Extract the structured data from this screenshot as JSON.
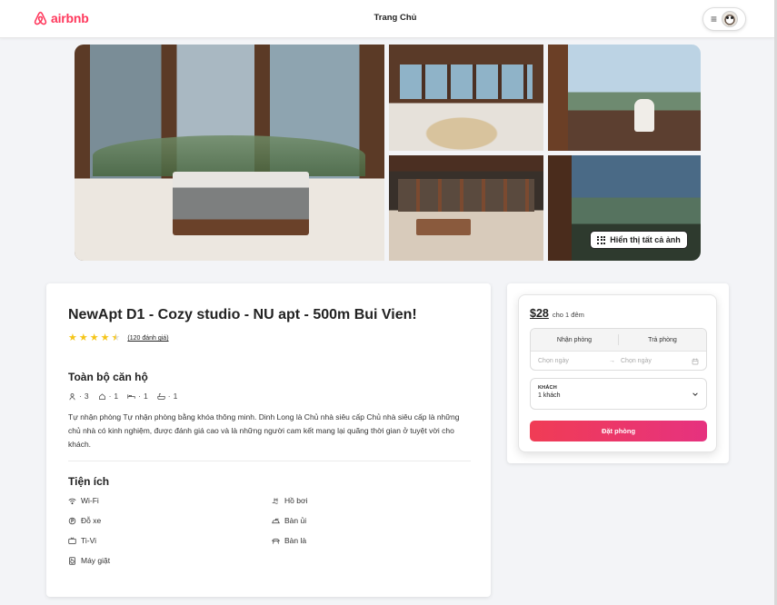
{
  "header": {
    "brand": "airbnb",
    "nav_title": "Trang Chủ",
    "menu_icon": "≡"
  },
  "gallery": {
    "show_all_label": "Hiển thị tất cả ảnh",
    "photos": [
      "bedroom-main",
      "living-room",
      "woman-window",
      "bedroom-wide",
      "woman-view"
    ]
  },
  "listing": {
    "title": "NewApt D1 - Cozy studio - NU apt - 500m Bui Vien!",
    "rating": 4.5,
    "rating_max": 5,
    "reviews_label": "(120 đánh giá)",
    "type_title": "Toàn bộ căn hộ",
    "specs": [
      {
        "icon": "guests-icon",
        "value": "3"
      },
      {
        "icon": "bedroom-icon",
        "value": "1"
      },
      {
        "icon": "bed-icon",
        "value": "1"
      },
      {
        "icon": "bath-icon",
        "value": "1"
      }
    ],
    "description": "Tự nhận phòng Tự nhận phòng bằng khóa thông minh. Dinh Long là Chủ nhà siêu cấp Chủ nhà siêu cấp là những chủ nhà có kinh nghiệm, được đánh giá cao và là những người cam kết mang lại quãng thời gian ở tuyệt vời cho khách.",
    "amenities_title": "Tiện ích",
    "amenities": [
      {
        "label": "Wi-Fi",
        "icon": "wifi-icon"
      },
      {
        "label": "Hồ bơi",
        "icon": "pool-icon"
      },
      {
        "label": "Đỗ xe",
        "icon": "parking-icon"
      },
      {
        "label": "Bàn ủi",
        "icon": "iron-icon"
      },
      {
        "label": "Ti-Vi",
        "icon": "tv-icon"
      },
      {
        "label": "Bàn là",
        "icon": "iron-board-icon"
      },
      {
        "label": "Máy giặt",
        "icon": "washer-icon"
      }
    ]
  },
  "booking": {
    "price": "$28",
    "price_unit": "cho 1 đêm",
    "checkin_label": "Nhận phòng",
    "checkout_label": "Trả phòng",
    "checkin_placeholder": "Chọn ngày",
    "checkout_placeholder": "Chọn ngày",
    "guests_label": "KHÁCH",
    "guests_value": "1 khách",
    "book_label": "Đặt phòng"
  },
  "colors": {
    "brand": "#ff385c",
    "star": "#f5c518",
    "button_start": "#f03c55",
    "button_end": "#e6327f"
  }
}
